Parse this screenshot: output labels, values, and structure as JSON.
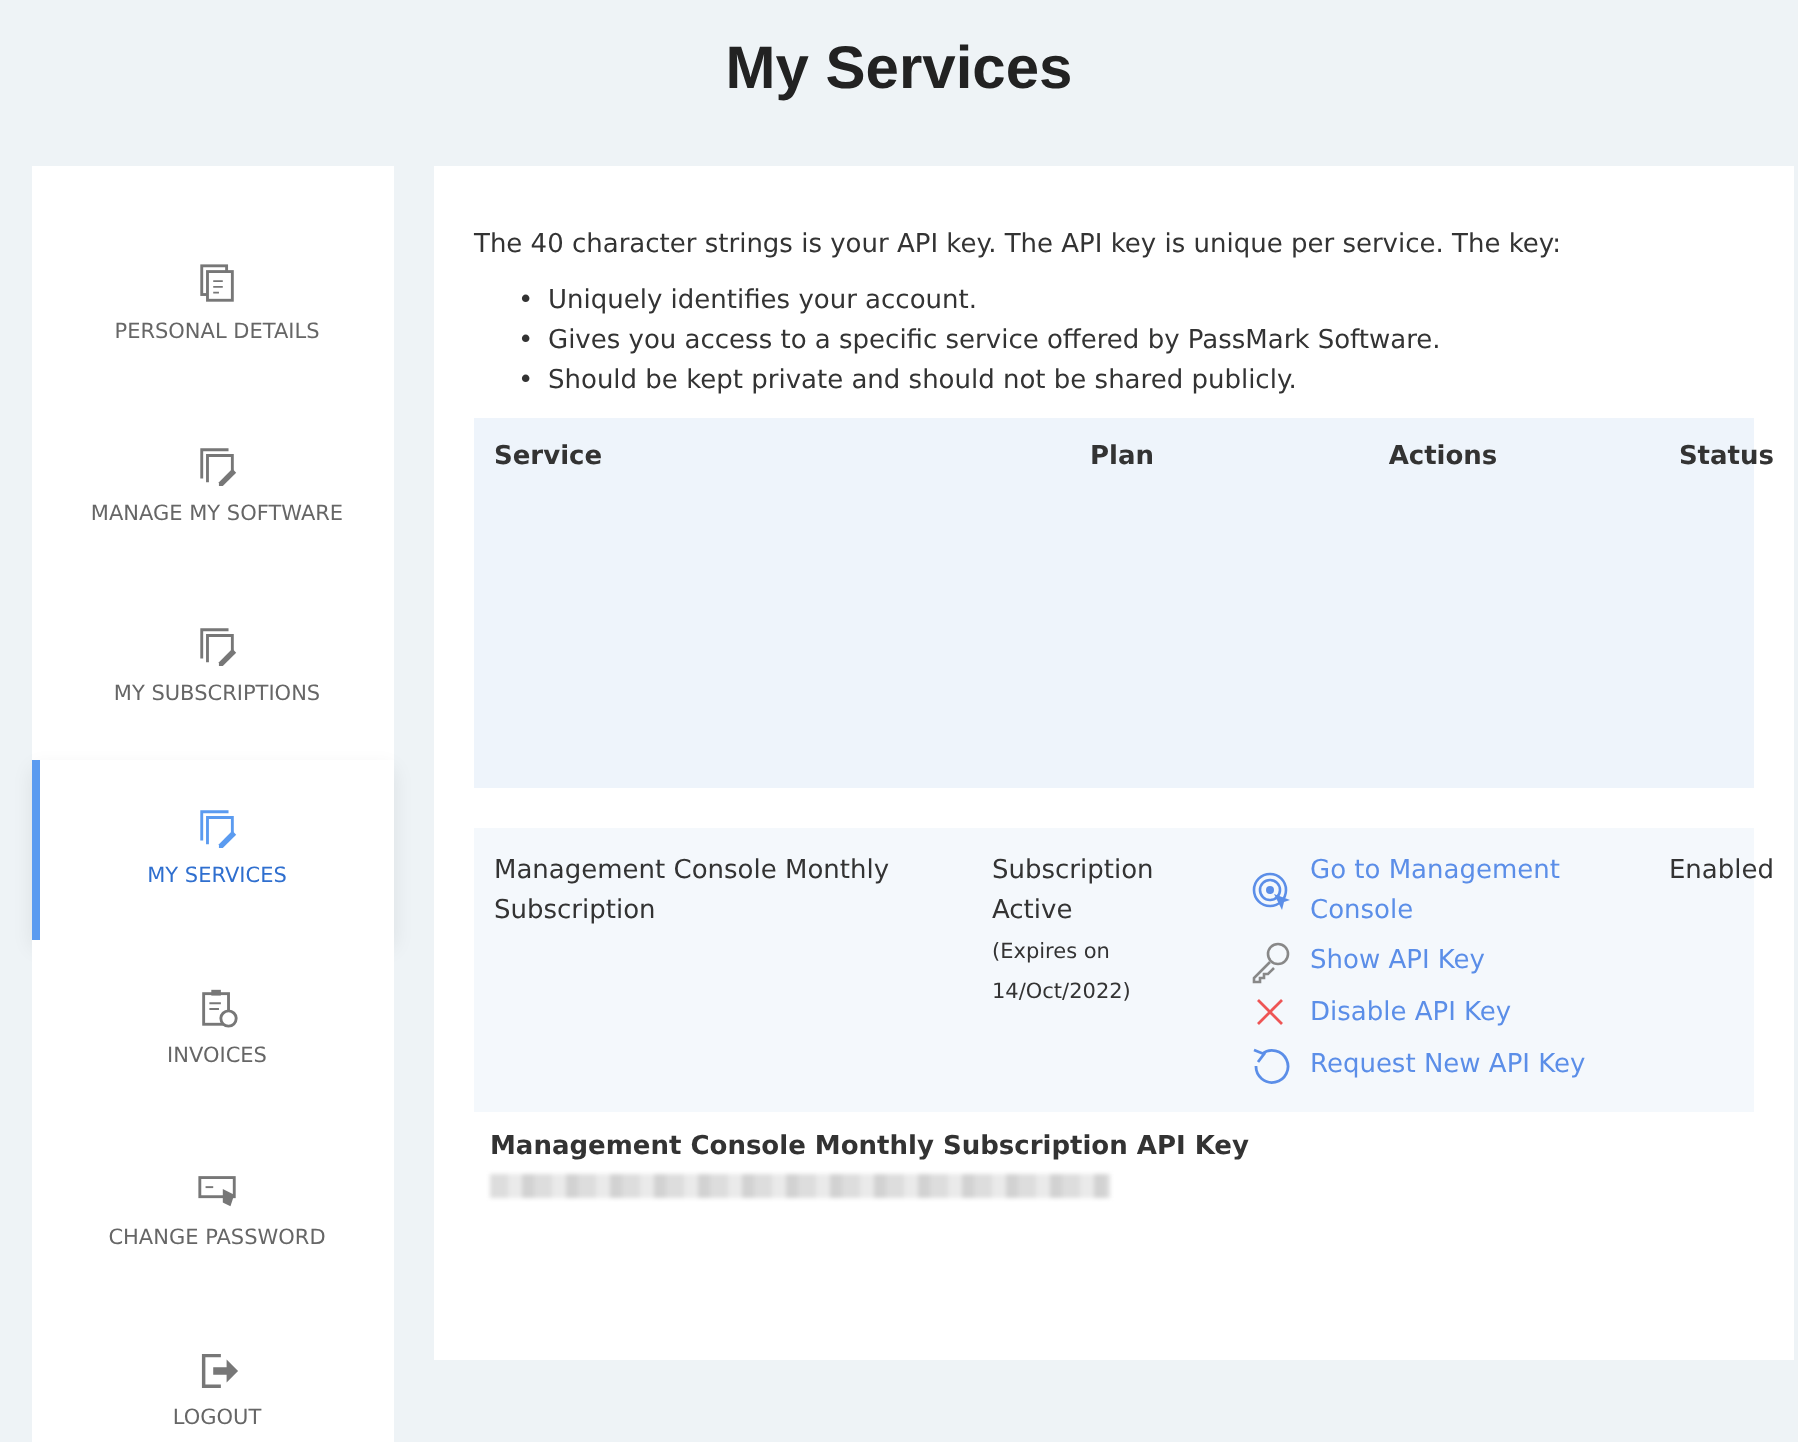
{
  "title": "My Services",
  "sidebar": {
    "items": [
      {
        "label": "PERSONAL DETAILS",
        "kind": "details",
        "selected": false
      },
      {
        "label": "MANAGE MY SOFTWARE",
        "kind": "edit",
        "selected": false
      },
      {
        "label": "MY SUBSCRIPTIONS",
        "kind": "edit",
        "selected": false
      },
      {
        "label": "MY SERVICES",
        "kind": "edit",
        "selected": true
      },
      {
        "label": "INVOICES",
        "kind": "clipboard",
        "selected": false
      },
      {
        "label": "CHANGE PASSWORD",
        "kind": "password",
        "selected": false
      },
      {
        "label": "LOGOUT",
        "kind": "logout",
        "selected": false
      }
    ]
  },
  "intro": "The 40 character strings is your API key. The API key is unique per service. The key:",
  "bullets": [
    {
      "marker": "•",
      "text": "Uniquely identifies your account."
    },
    {
      "marker": "•",
      "text": "Gives you access to a specific service offered by PassMark Software."
    },
    {
      "marker": "•",
      "text": "Should be kept private and should not be shared publicly."
    }
  ],
  "table": {
    "columns": [
      "Service",
      "Plan",
      "Actions",
      "Status"
    ],
    "rows": [
      {
        "service": "Management Console Monthly Subscription",
        "plan": "Subscription Active",
        "expires": "(Expires on 14/Oct/2022)",
        "status": "Enabled",
        "actions": [
          {
            "label": "Go to Management Console",
            "kind": "target"
          },
          {
            "label": "Show API Key",
            "kind": "key"
          },
          {
            "label": "Disable API Key",
            "kind": "cross"
          },
          {
            "label": "Request New API Key",
            "kind": "refresh"
          }
        ]
      }
    ]
  },
  "api_key": {
    "title": "Management Console Monthly Subscription API Key"
  }
}
